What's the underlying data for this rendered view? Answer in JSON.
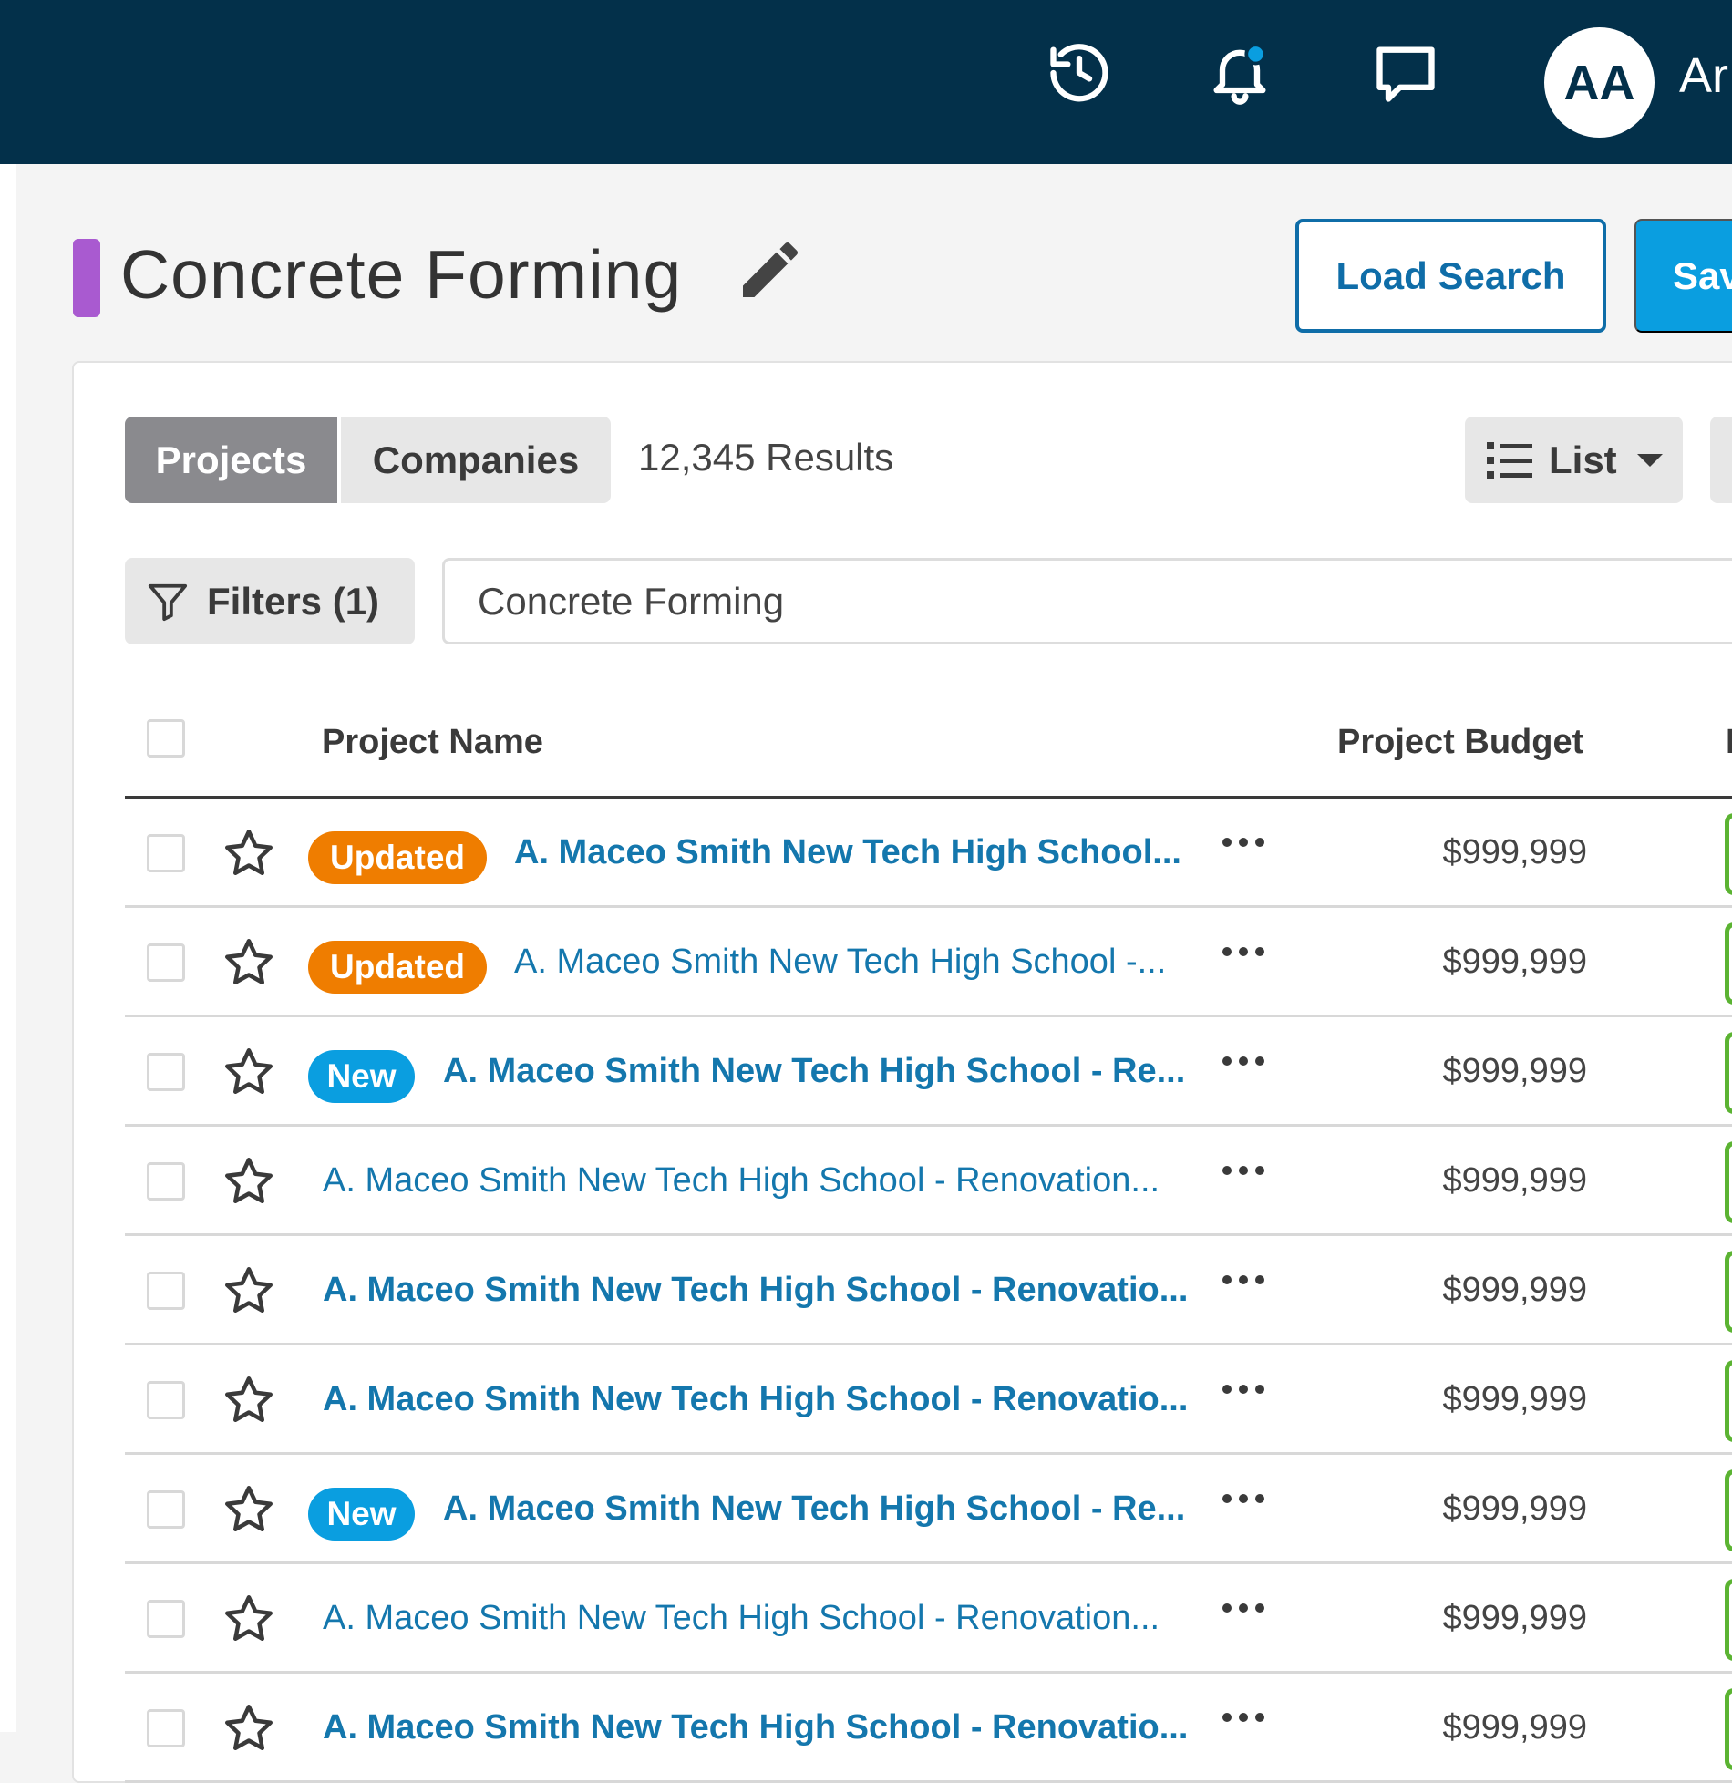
{
  "header": {
    "avatar_initials": "AA",
    "user_name": "Ar",
    "icons": [
      "history-icon",
      "bell-icon",
      "chat-icon"
    ],
    "colors": {
      "background": "#03304a",
      "notification_dot": "#0a9ee0"
    }
  },
  "page": {
    "title": "Concrete Forming",
    "title_marker_color": "#a95ad0",
    "load_search_label": "Load Search",
    "save_label": "Sav"
  },
  "toolbar": {
    "tabs": [
      {
        "label": "Projects",
        "active": true
      },
      {
        "label": "Companies",
        "active": false
      }
    ],
    "results": "12,345 Results",
    "view_label": "List",
    "filters_label": "Filters (1)",
    "search_value": "Concrete Forming"
  },
  "table": {
    "columns": {
      "name": "Project Name",
      "budget": "Project Budget",
      "next": "I"
    },
    "rows": [
      {
        "badge": "Updated",
        "badge_type": "updated",
        "name": "A. Maceo Smith New Tech High School...",
        "bold": true,
        "budget": "$999,999"
      },
      {
        "badge": "Updated",
        "badge_type": "updated",
        "name": "A. Maceo Smith New Tech High School -...",
        "bold": false,
        "budget": "$999,999"
      },
      {
        "badge": "New",
        "badge_type": "new",
        "name": "A. Maceo Smith New Tech High School - Re...",
        "bold": true,
        "budget": "$999,999"
      },
      {
        "badge": "",
        "badge_type": "",
        "name": "A. Maceo Smith New Tech High School - Renovation...",
        "bold": false,
        "budget": "$999,999"
      },
      {
        "badge": "",
        "badge_type": "",
        "name": "A. Maceo Smith New Tech High School - Renovatio...",
        "bold": true,
        "budget": "$999,999"
      },
      {
        "badge": "",
        "badge_type": "",
        "name": "A. Maceo Smith New Tech High School - Renovatio...",
        "bold": true,
        "budget": "$999,999"
      },
      {
        "badge": "New",
        "badge_type": "new",
        "name": "A. Maceo Smith New Tech High School - Re...",
        "bold": true,
        "budget": "$999,999"
      },
      {
        "badge": "",
        "badge_type": "",
        "name": "A. Maceo Smith New Tech High School - Renovation...",
        "bold": false,
        "budget": "$999,999"
      },
      {
        "badge": "",
        "badge_type": "",
        "name": "A. Maceo Smith New Tech High School - Renovatio...",
        "bold": true,
        "budget": "$999,999"
      }
    ],
    "colors": {
      "link": "#1477ad",
      "updated": "#ef7d00",
      "new": "#0a9ee0",
      "status": "#5bb332"
    }
  }
}
